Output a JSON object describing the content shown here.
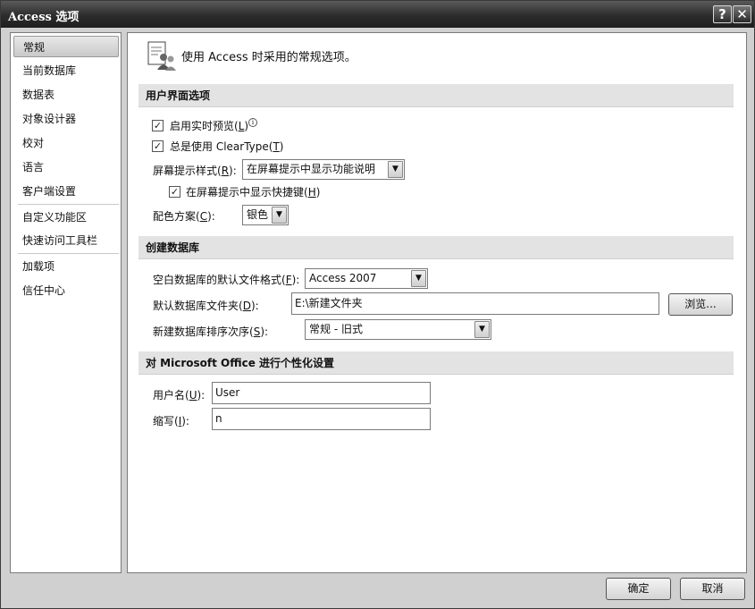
{
  "window": {
    "title": "Access 选项",
    "help_glyph": "?",
    "close_glyph": "✕"
  },
  "sidebar": {
    "items": [
      {
        "label": "常规"
      },
      {
        "label": "当前数据库"
      },
      {
        "label": "数据表"
      },
      {
        "label": "对象设计器"
      },
      {
        "label": "校对"
      },
      {
        "label": "语言"
      },
      {
        "label": "客户端设置"
      },
      {
        "label": "自定义功能区"
      },
      {
        "label": "快速访问工具栏"
      },
      {
        "label": "加载项"
      },
      {
        "label": "信任中心"
      }
    ],
    "selected": "常规"
  },
  "main": {
    "header_text": "使用 Access 时采用的常规选项。",
    "header_icon": "general-options-icon",
    "ui_section": {
      "title": "用户界面选项",
      "live_preview": {
        "text": "启用实时预览(",
        "key": "L",
        "end": ")",
        "checked": true
      },
      "cleartype": {
        "text": "总是使用 ClearType(",
        "key": "T",
        "end": ")",
        "checked": true
      },
      "screentip_style": {
        "text": "屏幕提示样式(",
        "key": "R",
        "end": "):",
        "value": "在屏幕提示中显示功能说明"
      },
      "show_shortcut": {
        "text": "在屏幕提示中显示快捷键(",
        "key": "H",
        "end": ")",
        "checked": true
      },
      "color_scheme": {
        "text": "配色方案(",
        "key": "C",
        "end": "):",
        "value": "银色"
      }
    },
    "db_section": {
      "title": "创建数据库",
      "file_format": {
        "text": "空白数据库的默认文件格式(",
        "key": "F",
        "end": "):",
        "value": "Access 2007"
      },
      "folder": {
        "text": "默认数据库文件夹(",
        "key": "D",
        "end": "):",
        "value": "E:\\新建文件夹"
      },
      "browse_label": "浏览...",
      "sort_order": {
        "text": "新建数据库排序次序(",
        "key": "S",
        "end": "):",
        "value": "常规 - 旧式"
      }
    },
    "personal_section": {
      "title": "对 Microsoft Office 进行个性化设置",
      "username": {
        "text": "用户名(",
        "key": "U",
        "end": "):",
        "value": "User"
      },
      "initials": {
        "text": "缩写(",
        "key": "I",
        "end": "):",
        "value": "n"
      }
    }
  },
  "footer": {
    "ok_label": "确定",
    "cancel_label": "取消"
  },
  "colors": {
    "titlebar": "#2c2c2c",
    "section_bg": "#e3e3e3",
    "dialog_bg": "#d0d0d0"
  }
}
